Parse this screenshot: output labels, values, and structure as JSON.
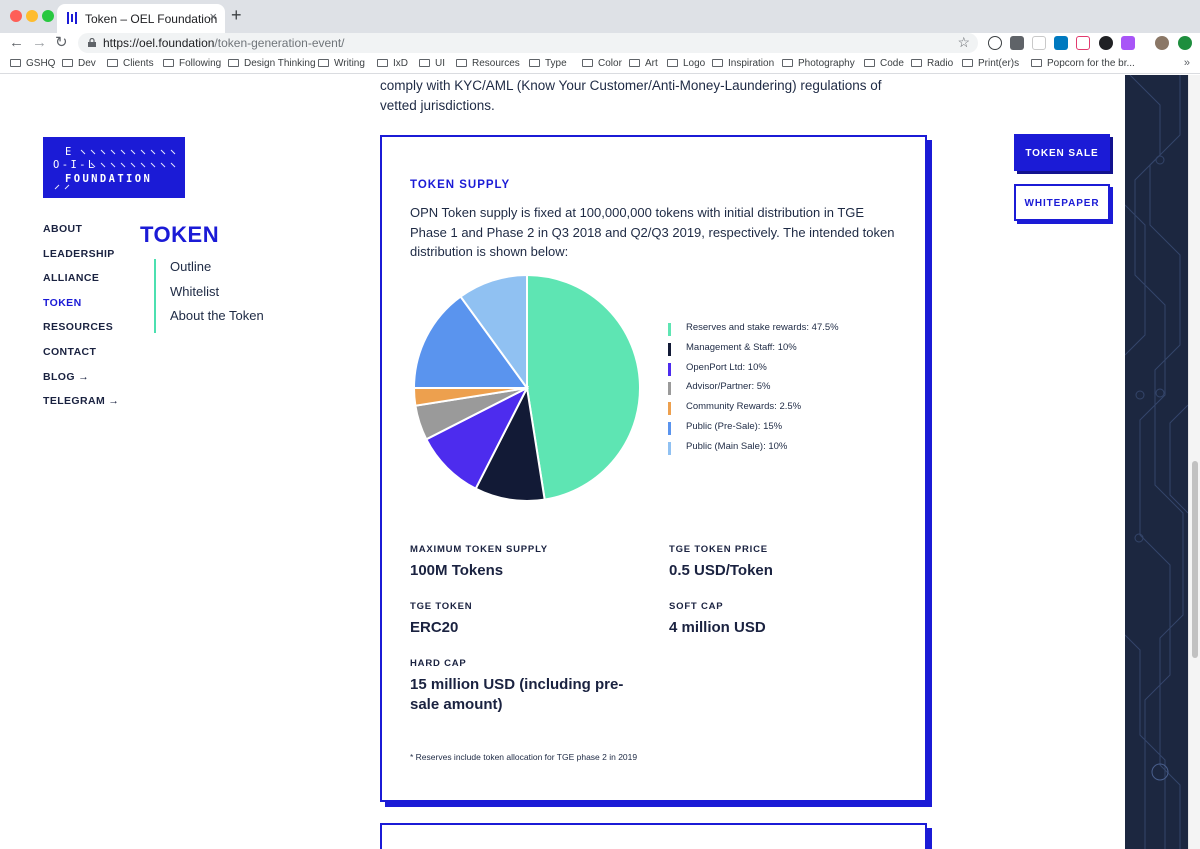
{
  "browser": {
    "tab_title": "Token – OEL Foundation",
    "tab_close": "×",
    "new_tab": "+",
    "url_host": "https://oel.foundation",
    "url_path": "/token-generation-event/",
    "bookmarks": [
      "GSHQ",
      "Dev",
      "Clients",
      "Following",
      "Design Thinking",
      "Writing",
      "IxD",
      "UI",
      "Resources",
      "Type",
      "Color",
      "Art",
      "Logo",
      "Inspiration",
      "Photography",
      "Code",
      "Radio",
      "Print(er)s",
      "Popcorn for the br..."
    ],
    "bookmarks_more": "»"
  },
  "page": {
    "intro_text": "comply with KYC/AML (Know Your Customer/Anti-Money-Laundering) regulations of vetted jurisdictions.",
    "logo": {
      "line1": "E",
      "line2": "O-I-L",
      "line3": "FOUNDATION"
    },
    "side_nav": [
      {
        "label": "ABOUT"
      },
      {
        "label": "LEADERSHIP"
      },
      {
        "label": "ALLIANCE"
      },
      {
        "label": "TOKEN"
      },
      {
        "label": "RESOURCES"
      },
      {
        "label": "CONTACT"
      },
      {
        "label": "BLOG →"
      },
      {
        "label": "TELEGRAM →"
      }
    ],
    "section_title": "TOKEN",
    "sub_nav": [
      {
        "label": "Outline"
      },
      {
        "label": "Whitelist"
      },
      {
        "label": "About the Token"
      }
    ],
    "buttons": {
      "token_sale": "TOKEN SALE",
      "whitepaper": "WHITEPAPER"
    },
    "card": {
      "title": "TOKEN SUPPLY",
      "description": "OPN Token supply is fixed at 100,000,000 tokens with initial distribution in TGE Phase 1 and Phase 2 in Q3 2018 and Q2/Q3 2019, respectively. The intended token distribution is shown below:",
      "stats": [
        {
          "label": "MAXIMUM TOKEN SUPPLY",
          "value": "100M Tokens"
        },
        {
          "label": "TGE TOKEN PRICE",
          "value": "0.5 USD/Token"
        },
        {
          "label": "TGE TOKEN",
          "value": "ERC20"
        },
        {
          "label": "SOFT CAP",
          "value": "4 million USD"
        },
        {
          "label": "HARD CAP",
          "value": "15 million USD (including pre-sale amount)"
        }
      ],
      "footnote": "* Reserves include token allocation for TGE phase 2 in 2019"
    }
  },
  "colors": {
    "brand_blue": "#1b1bd6",
    "navy": "#1a2240",
    "accent_green": "#4ce0b0"
  },
  "chart_data": {
    "type": "pie",
    "title": "",
    "legend_position": "right",
    "slices": [
      {
        "label": "Reserves and stake rewards: 47.5%",
        "value": 47.5,
        "color": "#5ee5b3"
      },
      {
        "label": "Management & Staff: 10%",
        "value": 10,
        "color": "#121a36"
      },
      {
        "label": "OpenPort Ltd: 10%",
        "value": 10,
        "color": "#4d2cee"
      },
      {
        "label": "Advisor/Partner: 5%",
        "value": 5,
        "color": "#9a9a9a"
      },
      {
        "label": "Community Rewards: 2.5%",
        "value": 2.5,
        "color": "#eda04e"
      },
      {
        "label": "Public (Pre-Sale): 15%",
        "value": 15,
        "color": "#5a94ee"
      },
      {
        "label": "Public (Main Sale): 10%",
        "value": 10,
        "color": "#90c1f2"
      }
    ]
  }
}
